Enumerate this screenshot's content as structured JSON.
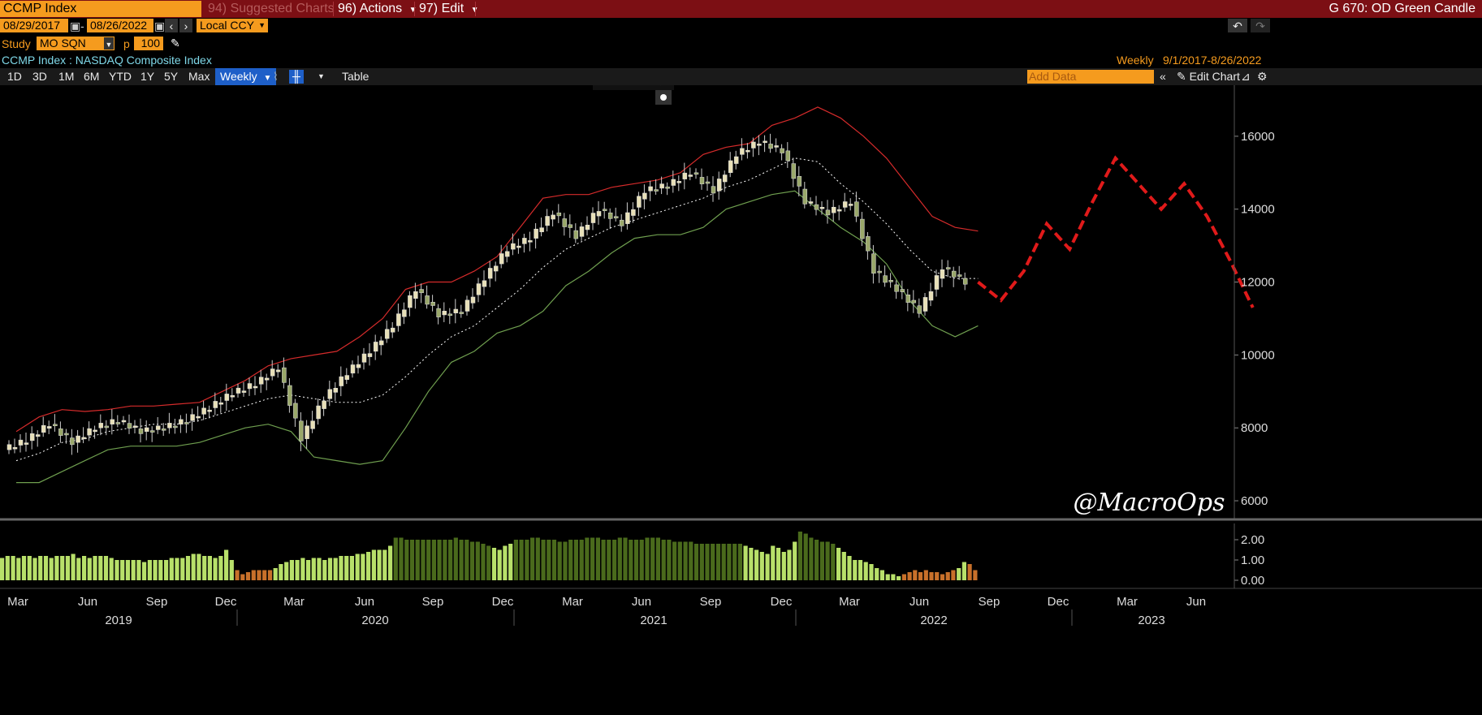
{
  "header": {
    "ticker_field": "CCMP Index",
    "suggested": "94) Suggested Charts",
    "actions": "96) Actions",
    "edit": "97) Edit",
    "chart_type": "G 670: OD Green Candle"
  },
  "dates": {
    "start": "08/29/2017",
    "end": "08/26/2022",
    "currency": "Local CCY"
  },
  "study": {
    "label": "Study",
    "value": "MO SQN",
    "p_label": "p",
    "p_value": "100"
  },
  "security": {
    "name": "CCMP Index : NASDAQ Composite Index",
    "frequency": "Weekly",
    "range": "9/1/2017-8/26/2022"
  },
  "toolbar": {
    "periods": [
      "1D",
      "3D",
      "1M",
      "6M",
      "YTD",
      "1Y",
      "5Y",
      "Max"
    ],
    "frequency": "Weekly",
    "table": "Table",
    "add_data_placeholder": "Add Data",
    "edit_chart": "Edit Chart"
  },
  "watermark": "@MacroOps",
  "colors": {
    "background": "#000000",
    "header_red": "#7c0f14",
    "orange": "#f59b1e",
    "upper_band": "#d52b2b",
    "lower_band": "#6f9f4f",
    "mid_band": "#ffffff",
    "candle_up": "#e8e0b8",
    "candle_down": "#9aa86a",
    "projection": "#e01a1a",
    "hist_light": "#b8e06a",
    "hist_dark": "#4a6a1c",
    "hist_orange": "#c8702a"
  },
  "chart_data": [
    {
      "type": "candlestick",
      "title": "CCMP Index : NASDAQ Composite Index",
      "frequency": "Weekly",
      "y_axis": {
        "ticks": [
          6000,
          8000,
          10000,
          12000,
          14000,
          16000
        ],
        "ylim": [
          5600,
          17400
        ],
        "position": "right"
      },
      "x_axis": {
        "month_ticks": [
          "Mar",
          "Jun",
          "Sep",
          "Dec",
          "Mar",
          "Jun",
          "Sep",
          "Dec",
          "Mar",
          "Jun",
          "Sep",
          "Dec",
          "Mar",
          "Jun",
          "Sep",
          "Dec",
          "Mar",
          "Jun"
        ],
        "years": [
          "2019",
          "2020",
          "2021",
          "2022",
          "2023"
        ]
      },
      "series_close": {
        "x": [
          "2019-02",
          "2019-03",
          "2019-04",
          "2019-05",
          "2019-06",
          "2019-07",
          "2019-08",
          "2019-09",
          "2019-10",
          "2019-11",
          "2019-12",
          "2020-01",
          "2020-02",
          "2020-03",
          "2020-04",
          "2020-05",
          "2020-06",
          "2020-07",
          "2020-08",
          "2020-09",
          "2020-10",
          "2020-11",
          "2020-12",
          "2021-01",
          "2021-02",
          "2021-03",
          "2021-04",
          "2021-05",
          "2021-06",
          "2021-07",
          "2021-08",
          "2021-09",
          "2021-10",
          "2021-11",
          "2021-12",
          "2022-01",
          "2022-02",
          "2022-03",
          "2022-04",
          "2022-05",
          "2022-06",
          "2022-07",
          "2022-08"
        ],
        "close": [
          7400,
          7650,
          8100,
          7600,
          8000,
          8200,
          7900,
          8000,
          8200,
          8550,
          8950,
          9200,
          9650,
          7700,
          8800,
          9500,
          10100,
          10800,
          11800,
          11100,
          11200,
          12100,
          12900,
          13200,
          13900,
          13250,
          14000,
          13600,
          14500,
          14650,
          15000,
          14500,
          15500,
          15850,
          15600,
          14200,
          13900,
          14200,
          12300,
          11800,
          11200,
          12400,
          12000
        ]
      },
      "bands": {
        "upper": [
          7900,
          8300,
          8500,
          8450,
          8500,
          8600,
          8600,
          8650,
          8700,
          9000,
          9300,
          9700,
          9900,
          10000,
          10100,
          10500,
          11000,
          11800,
          12000,
          12000,
          12300,
          12700,
          13500,
          14300,
          14400,
          14400,
          14600,
          14700,
          14800,
          15000,
          15500,
          15700,
          15800,
          16300,
          16500,
          16800,
          16500,
          16000,
          15400,
          14600,
          13800,
          13500,
          13400
        ],
        "lower": [
          6500,
          6500,
          6800,
          7100,
          7400,
          7500,
          7500,
          7500,
          7600,
          7800,
          8000,
          8100,
          7900,
          7200,
          7100,
          7000,
          7100,
          8000,
          9000,
          9800,
          10100,
          10600,
          10800,
          11200,
          11900,
          12300,
          12800,
          13200,
          13300,
          13300,
          13500,
          14000,
          14200,
          14400,
          14500,
          14000,
          13500,
          13100,
          12500,
          11500,
          10800,
          10500,
          10800
        ],
        "mid": [
          7100,
          7300,
          7600,
          7700,
          7900,
          8000,
          8100,
          8100,
          8200,
          8400,
          8600,
          8800,
          8900,
          8800,
          8700,
          8700,
          8900,
          9400,
          10000,
          10500,
          10800,
          11300,
          11800,
          12400,
          12900,
          13200,
          13500,
          13700,
          13900,
          14100,
          14300,
          14600,
          14800,
          15100,
          15400,
          15300,
          14700,
          14200,
          13600,
          12900,
          12300,
          12100,
          12100
        ]
      }
    },
    {
      "type": "line",
      "name": "projection",
      "style": "dashed",
      "x": [
        "2022-09",
        "2022-10",
        "2022-11",
        "2022-12",
        "2023-01",
        "2023-02",
        "2023-03",
        "2023-04",
        "2023-05",
        "2023-06",
        "2023-07",
        "2023-08"
      ],
      "values": [
        11500,
        12300,
        13600,
        12900,
        14200,
        15400,
        14700,
        14000,
        14700,
        13800,
        12600,
        11300
      ]
    },
    {
      "type": "bar",
      "name": "MO SQN",
      "y_axis": {
        "ticks": [
          "2.00",
          "1.00",
          "0.00"
        ],
        "ylim": [
          -0.2,
          2.6
        ]
      },
      "values": [
        1.1,
        1.2,
        1.2,
        1.1,
        1.2,
        1.2,
        1.1,
        1.2,
        1.2,
        1.1,
        1.2,
        1.2,
        1.2,
        1.3,
        1.1,
        1.2,
        1.1,
        1.2,
        1.2,
        1.2,
        1.1,
        1.0,
        1.0,
        1.0,
        1.0,
        1.0,
        0.9,
        1.0,
        1.0,
        1.0,
        1.0,
        1.1,
        1.1,
        1.1,
        1.2,
        1.3,
        1.3,
        1.2,
        1.2,
        1.1,
        1.2,
        1.5,
        1.0,
        0.5,
        0.3,
        0.4,
        0.5,
        0.5,
        0.5,
        0.5,
        0.6,
        0.8,
        0.9,
        1.0,
        1.0,
        1.1,
        1.0,
        1.1,
        1.1,
        1.0,
        1.1,
        1.1,
        1.2,
        1.2,
        1.2,
        1.3,
        1.3,
        1.4,
        1.5,
        1.5,
        1.5,
        1.7,
        2.1,
        2.1,
        2.0,
        2.0,
        2.0,
        2.0,
        2.0,
        2.0,
        2.0,
        2.0,
        2.0,
        2.1,
        2.0,
        2.0,
        1.9,
        1.9,
        1.8,
        1.7,
        1.6,
        1.5,
        1.7,
        1.8,
        2.0,
        2.0,
        2.0,
        2.1,
        2.1,
        2.0,
        2.0,
        2.0,
        1.9,
        1.9,
        2.0,
        2.0,
        2.0,
        2.1,
        2.1,
        2.1,
        2.0,
        2.0,
        2.0,
        2.1,
        2.1,
        2.0,
        2.0,
        2.0,
        2.1,
        2.1,
        2.1,
        2.0,
        2.0,
        1.9,
        1.9,
        1.9,
        1.9,
        1.8,
        1.8,
        1.8,
        1.8,
        1.8,
        1.8,
        1.8,
        1.8,
        1.8,
        1.7,
        1.6,
        1.5,
        1.4,
        1.3,
        1.7,
        1.6,
        1.4,
        1.5,
        1.9,
        2.4,
        2.3,
        2.1,
        2.0,
        1.9,
        1.9,
        1.8,
        1.6,
        1.4,
        1.2,
        1.0,
        1.0,
        0.9,
        0.8,
        0.6,
        0.5,
        0.3,
        0.3,
        0.2,
        0.3,
        0.4,
        0.5,
        0.4,
        0.5,
        0.4,
        0.4,
        0.3,
        0.4,
        0.5,
        0.6,
        0.9,
        0.8,
        0.5
      ],
      "colors": [
        "l",
        "l",
        "l",
        "l",
        "l",
        "l",
        "l",
        "l",
        "l",
        "l",
        "l",
        "l",
        "l",
        "l",
        "l",
        "l",
        "l",
        "l",
        "l",
        "l",
        "l",
        "l",
        "l",
        "l",
        "l",
        "l",
        "l",
        "l",
        "l",
        "l",
        "l",
        "l",
        "l",
        "l",
        "l",
        "l",
        "l",
        "l",
        "l",
        "l",
        "l",
        "l",
        "l",
        "o",
        "o",
        "o",
        "o",
        "o",
        "o",
        "o",
        "l",
        "l",
        "l",
        "l",
        "l",
        "l",
        "l",
        "l",
        "l",
        "l",
        "l",
        "l",
        "l",
        "l",
        "l",
        "l",
        "l",
        "l",
        "l",
        "l",
        "l",
        "l",
        "d",
        "d",
        "d",
        "d",
        "d",
        "d",
        "d",
        "d",
        "d",
        "d",
        "d",
        "d",
        "d",
        "d",
        "d",
        "d",
        "d",
        "d",
        "l",
        "l",
        "l",
        "l",
        "d",
        "d",
        "d",
        "d",
        "d",
        "d",
        "d",
        "d",
        "d",
        "d",
        "d",
        "d",
        "d",
        "d",
        "d",
        "d",
        "d",
        "d",
        "d",
        "d",
        "d",
        "d",
        "d",
        "d",
        "d",
        "d",
        "d",
        "d",
        "d",
        "d",
        "d",
        "d",
        "d",
        "d",
        "d",
        "d",
        "d",
        "d",
        "d",
        "d",
        "d",
        "d",
        "l",
        "l",
        "l",
        "l",
        "l",
        "l",
        "l",
        "l",
        "l",
        "l",
        "d",
        "d",
        "d",
        "d",
        "d",
        "d",
        "d",
        "l",
        "l",
        "l",
        "l",
        "l",
        "l",
        "l",
        "l",
        "l",
        "l",
        "l",
        "l",
        "o",
        "o",
        "o",
        "o",
        "o",
        "o",
        "o",
        "o",
        "o",
        "o",
        "l",
        "l",
        "o"
      ]
    }
  ]
}
